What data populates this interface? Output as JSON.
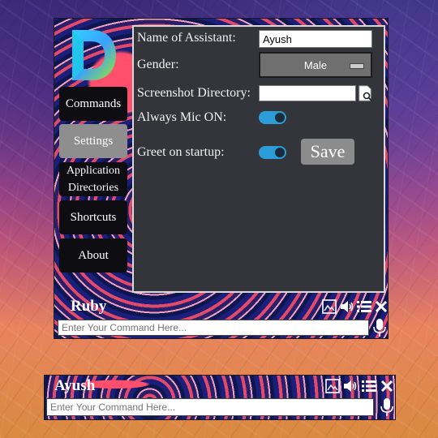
{
  "main": {
    "logo_letter": "D",
    "sidebar": {
      "items": [
        {
          "label": "Commands"
        },
        {
          "label": "Settings"
        },
        {
          "label": "Application Directories"
        },
        {
          "label": "Shortcuts"
        },
        {
          "label": "About"
        }
      ]
    },
    "settings": {
      "name_label": "Name of Assistant:",
      "name_value": "Ayush",
      "gender_label": "Gender:",
      "gender_value": "Male",
      "screenshot_label": "Screenshot Directory:",
      "screenshot_value": "",
      "mic_label": "Always Mic ON:",
      "mic_on": true,
      "greet_label": "Greet on startup:",
      "greet_on": true,
      "save_label": "Save"
    },
    "assistant_name": "Ruby",
    "command_placeholder": "Enter Your Command Here..."
  },
  "mini": {
    "assistant_name": "Ayush",
    "command_placeholder": "Enter Your Command Here..."
  },
  "colors": {
    "toggle_on": "#2b9cd8",
    "panel_bg": "#34353a",
    "sidebar_btn": "#0e0e12",
    "sidebar_active": "#8e8e8e"
  },
  "icons": [
    "image-icon",
    "speaker-icon",
    "list-icon",
    "close-icon",
    "microphone-icon",
    "file-search-icon"
  ]
}
